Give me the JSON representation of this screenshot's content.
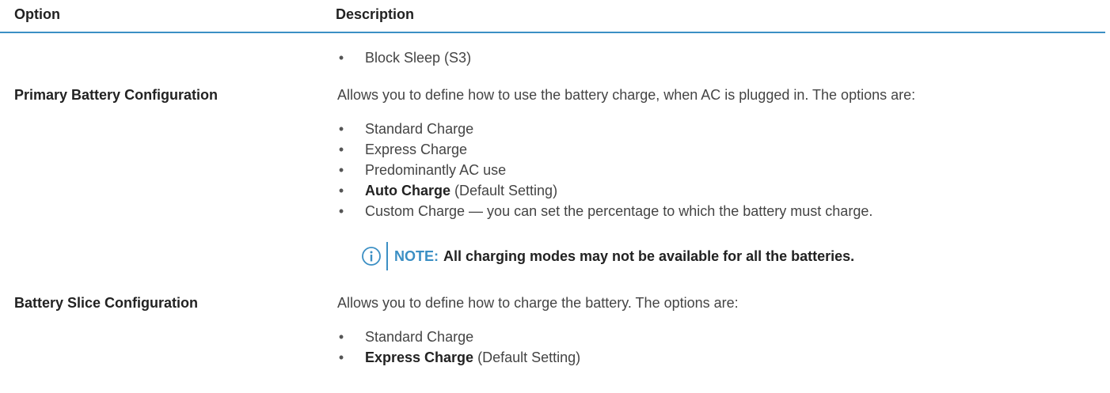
{
  "table": {
    "header": {
      "option": "Option",
      "description": "Description"
    },
    "continuation": {
      "bullets": [
        {
          "text": "Block Sleep (S3)"
        }
      ]
    },
    "rows": [
      {
        "option": "Primary Battery Configuration",
        "description": "Allows you to define how to use the battery charge, when AC is plugged in. The options are:",
        "bullets": [
          {
            "bold": "",
            "text": "Standard Charge"
          },
          {
            "bold": "",
            "text": "Express Charge"
          },
          {
            "bold": "",
            "text": "Predominantly AC use"
          },
          {
            "bold": "Auto Charge",
            "text": " (Default Setting)"
          },
          {
            "bold": "",
            "text": "Custom Charge — you can set the percentage to which the battery must charge."
          }
        ],
        "note": {
          "icon": "info-circle-icon",
          "label": "NOTE:",
          "text": "All charging modes may not be available for all the batteries."
        }
      },
      {
        "option": "Battery Slice Configuration",
        "description": "Allows you to define how to charge the battery. The options are:",
        "bullets": [
          {
            "bold": "",
            "text": "Standard Charge"
          },
          {
            "bold": "Express Charge",
            "text": " (Default Setting)"
          }
        ]
      }
    ]
  },
  "colors": {
    "accent": "#3b8fc4",
    "text": "#444444",
    "heading": "#222222"
  }
}
